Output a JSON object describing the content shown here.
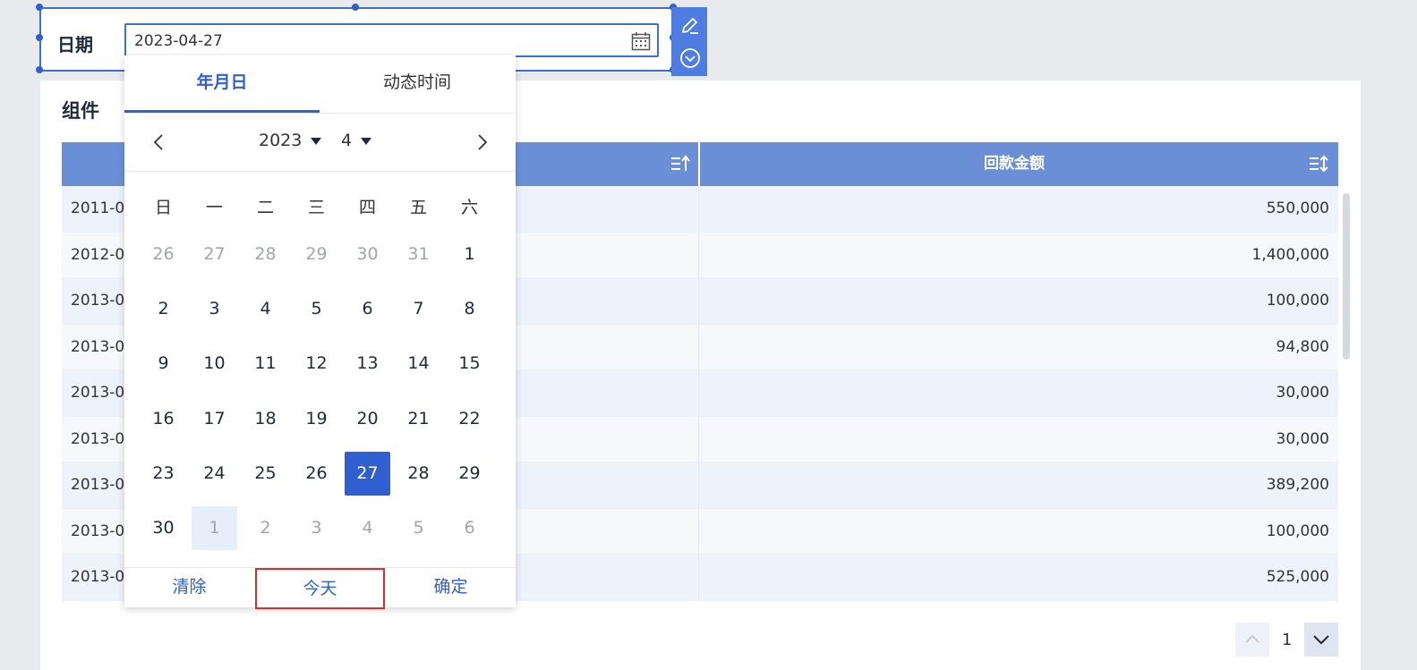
{
  "filter": {
    "label": "日期",
    "value": "2023-04-27",
    "calendar_icon": "calendar-icon"
  },
  "toolbar": {
    "edit_icon": "edit-icon",
    "dropdown_icon": "chevron-down-circle-icon"
  },
  "panel": {
    "title": "组件"
  },
  "table": {
    "headers": [
      "",
      "回款金额"
    ],
    "rows": [
      {
        "date": "2011-0",
        "amount": "550,000"
      },
      {
        "date": "2012-0",
        "amount": "1,400,000"
      },
      {
        "date": "2013-0",
        "amount": "100,000"
      },
      {
        "date": "2013-0",
        "amount": "94,800"
      },
      {
        "date": "2013-0",
        "amount": "30,000"
      },
      {
        "date": "2013-0",
        "amount": "30,000"
      },
      {
        "date": "2013-0",
        "amount": "389,200"
      },
      {
        "date": "2013-0",
        "amount": "100,000"
      },
      {
        "date": "2013-0",
        "amount": "525,000"
      }
    ]
  },
  "pagination": {
    "current_page": "1"
  },
  "calendar": {
    "tabs": [
      "年月日",
      "动态时间"
    ],
    "active_tab": 0,
    "year": "2023",
    "month": "4",
    "weekdays": [
      "日",
      "一",
      "二",
      "三",
      "四",
      "五",
      "六"
    ],
    "weeks": [
      [
        {
          "d": "26",
          "m": true
        },
        {
          "d": "27",
          "m": true
        },
        {
          "d": "28",
          "m": true
        },
        {
          "d": "29",
          "m": true
        },
        {
          "d": "30",
          "m": true
        },
        {
          "d": "31",
          "m": true
        },
        {
          "d": "1",
          "m": false
        }
      ],
      [
        {
          "d": "2",
          "m": false
        },
        {
          "d": "3",
          "m": false
        },
        {
          "d": "4",
          "m": false
        },
        {
          "d": "5",
          "m": false
        },
        {
          "d": "6",
          "m": false
        },
        {
          "d": "7",
          "m": false
        },
        {
          "d": "8",
          "m": false
        }
      ],
      [
        {
          "d": "9",
          "m": false
        },
        {
          "d": "10",
          "m": false
        },
        {
          "d": "11",
          "m": false
        },
        {
          "d": "12",
          "m": false
        },
        {
          "d": "13",
          "m": false
        },
        {
          "d": "14",
          "m": false
        },
        {
          "d": "15",
          "m": false
        }
      ],
      [
        {
          "d": "16",
          "m": false
        },
        {
          "d": "17",
          "m": false
        },
        {
          "d": "18",
          "m": false
        },
        {
          "d": "19",
          "m": false
        },
        {
          "d": "20",
          "m": false
        },
        {
          "d": "21",
          "m": false
        },
        {
          "d": "22",
          "m": false
        }
      ],
      [
        {
          "d": "23",
          "m": false
        },
        {
          "d": "24",
          "m": false
        },
        {
          "d": "25",
          "m": false
        },
        {
          "d": "26",
          "m": false
        },
        {
          "d": "27",
          "m": false,
          "selected": true
        },
        {
          "d": "28",
          "m": false
        },
        {
          "d": "29",
          "m": false
        }
      ],
      [
        {
          "d": "30",
          "m": false
        },
        {
          "d": "1",
          "m": true,
          "hover": true
        },
        {
          "d": "2",
          "m": true
        },
        {
          "d": "3",
          "m": true
        },
        {
          "d": "4",
          "m": true
        },
        {
          "d": "5",
          "m": true
        },
        {
          "d": "6",
          "m": true
        }
      ]
    ],
    "footer": {
      "clear": "清除",
      "today": "今天",
      "confirm": "确定"
    }
  },
  "colors": {
    "accent": "#2f5fd0",
    "header_bg": "#6a8fd6",
    "highlight_border": "#e02b2b"
  }
}
